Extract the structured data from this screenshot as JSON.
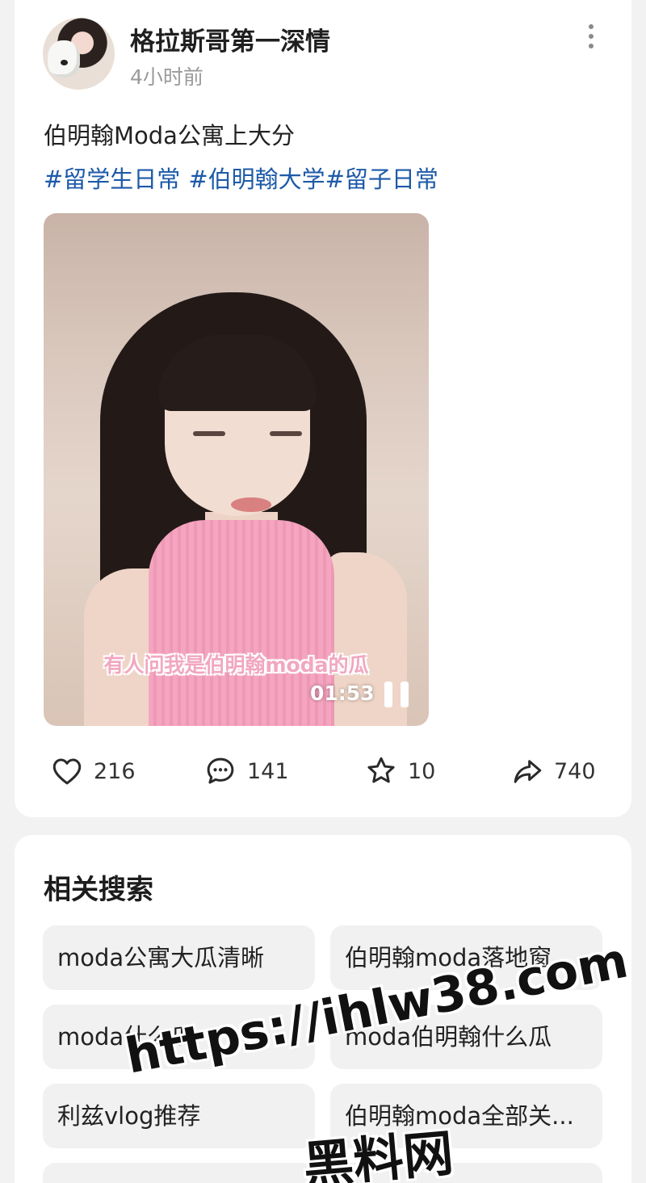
{
  "post": {
    "username": "格拉斯哥第一深情",
    "timestamp": "4小时前",
    "title": "伯明翰Moda公寓上大分",
    "tags": [
      "#留学生日常",
      "#伯明翰大学",
      "#留子日常"
    ],
    "video": {
      "caption": "有人问我是伯明翰moda的瓜",
      "duration": "01:53"
    },
    "actions": {
      "likes": "216",
      "comments": "141",
      "favorites": "10",
      "shares": "740"
    }
  },
  "related": {
    "title": "相关搜索",
    "chips": [
      "moda公寓大瓜清晰",
      "伯明翰moda落地窗",
      "moda什么瓜",
      "moda伯明翰什么瓜",
      "利兹vlog推荐",
      "伯明翰moda全部关..."
    ]
  },
  "watermark": {
    "url": "https://ihlw38.com",
    "name": "黑料网"
  },
  "colors": {
    "tag": "#1d5aa8",
    "caption": "#f1a7c0",
    "background": "#f2f2f2"
  }
}
